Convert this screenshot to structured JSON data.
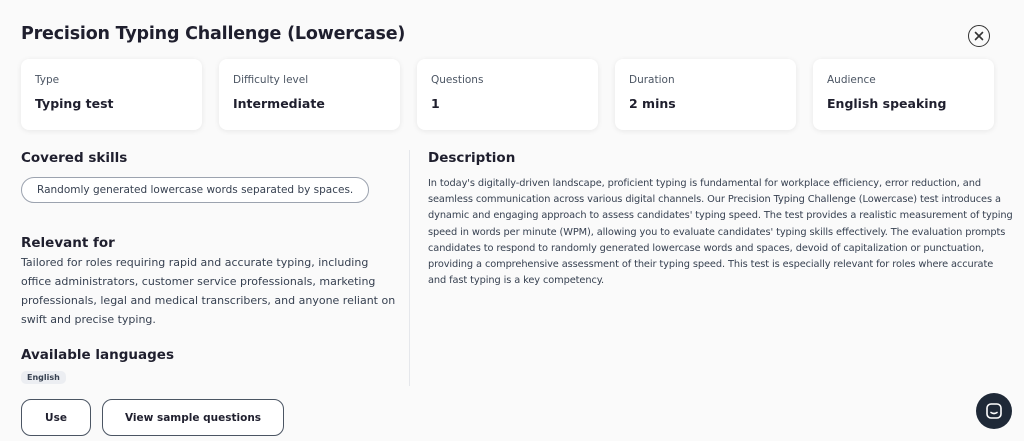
{
  "header": {
    "title": "Precision Typing Challenge (Lowercase)"
  },
  "info_cards": [
    {
      "label": "Type",
      "value": "Typing test"
    },
    {
      "label": "Difficulty level",
      "value": "Intermediate"
    },
    {
      "label": "Questions",
      "value": "1"
    },
    {
      "label": "Duration",
      "value": "2 mins"
    },
    {
      "label": "Audience",
      "value": "English speaking"
    }
  ],
  "covered_skills": {
    "heading": "Covered skills",
    "items": [
      "Randomly generated lowercase words separated by spaces."
    ]
  },
  "relevant_for": {
    "heading": "Relevant for",
    "text": "Tailored for roles requiring rapid and accurate typing, including office administrators, customer service professionals, marketing professionals, legal and medical transcribers, and anyone reliant on swift and precise typing."
  },
  "languages": {
    "heading": "Available languages",
    "items": [
      "English"
    ]
  },
  "description": {
    "heading": "Description",
    "text": "In today's digitally-driven landscape, proficient typing is fundamental for workplace efficiency, error reduction, and seamless communication across various digital channels. Our Precision Typing Challenge (Lowercase) test introduces a dynamic and engaging approach to assess candidates' typing speed. The test provides a realistic measurement of typing speed in words per minute (WPM), allowing you to evaluate candidates' typing skills effectively. The evaluation prompts candidates to respond to randomly generated lowercase words and spaces, devoid of capitalization or punctuation, providing a comprehensive assessment of their typing speed. This test is especially relevant for roles where accurate and fast typing is a key competency."
  },
  "actions": {
    "use_label": "Use",
    "sample_label": "View sample questions"
  },
  "icons": {
    "close": "close-icon",
    "chat": "chat-icon"
  },
  "colors": {
    "text_dark": "#1f1f2e",
    "fab_bg": "#1f2937",
    "background": "#fafafa"
  }
}
